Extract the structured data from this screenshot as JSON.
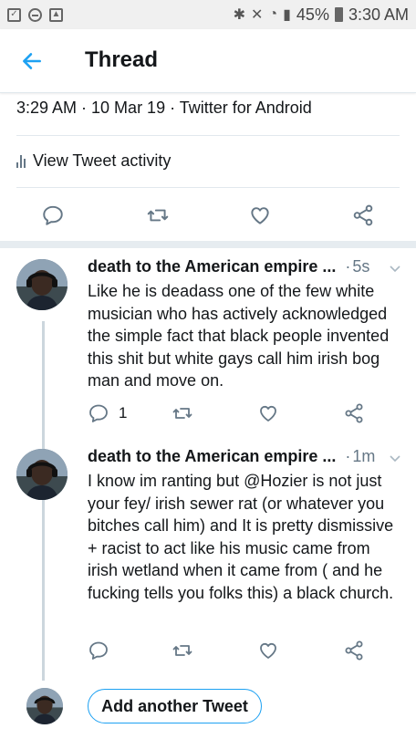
{
  "status_bar": {
    "battery": "45%",
    "time": "3:30 AM"
  },
  "header": {
    "title": "Thread"
  },
  "tweet_meta": {
    "text": "3:29 AM · 10 Mar 19 · Twitter for Android"
  },
  "activity": {
    "label": "View Tweet activity"
  },
  "tweets": [
    {
      "name": "death to the American empire ...",
      "separator": "·",
      "time": "5s",
      "text": "Like he is deadass one of the few white musician who has actively acknowledged the simple fact that black people invented this shit but white gays call him irish bog man and move on.",
      "reply_count": "1"
    },
    {
      "name": "death to the American empire ...",
      "separator": "·",
      "time": "1m",
      "text": "I know im ranting but @Hozier is not just your fey/ irish sewer rat (or whatever you bitches call him) and  It is pretty dismissive + racist to act like his music came from irish wetland when it came from ( and he fucking tells you folks this) a black church.",
      "reply_count": ""
    }
  ],
  "compose": {
    "add_label": "Add another Tweet"
  },
  "colors": {
    "accent": "#1da1f2",
    "icon_gray": "#657786",
    "divider": "#e1e8ed"
  },
  "icons": [
    "back-arrow-icon",
    "reply-icon",
    "retweet-icon",
    "like-icon",
    "share-icon",
    "chevron-down-icon",
    "activity-bars-icon"
  ]
}
